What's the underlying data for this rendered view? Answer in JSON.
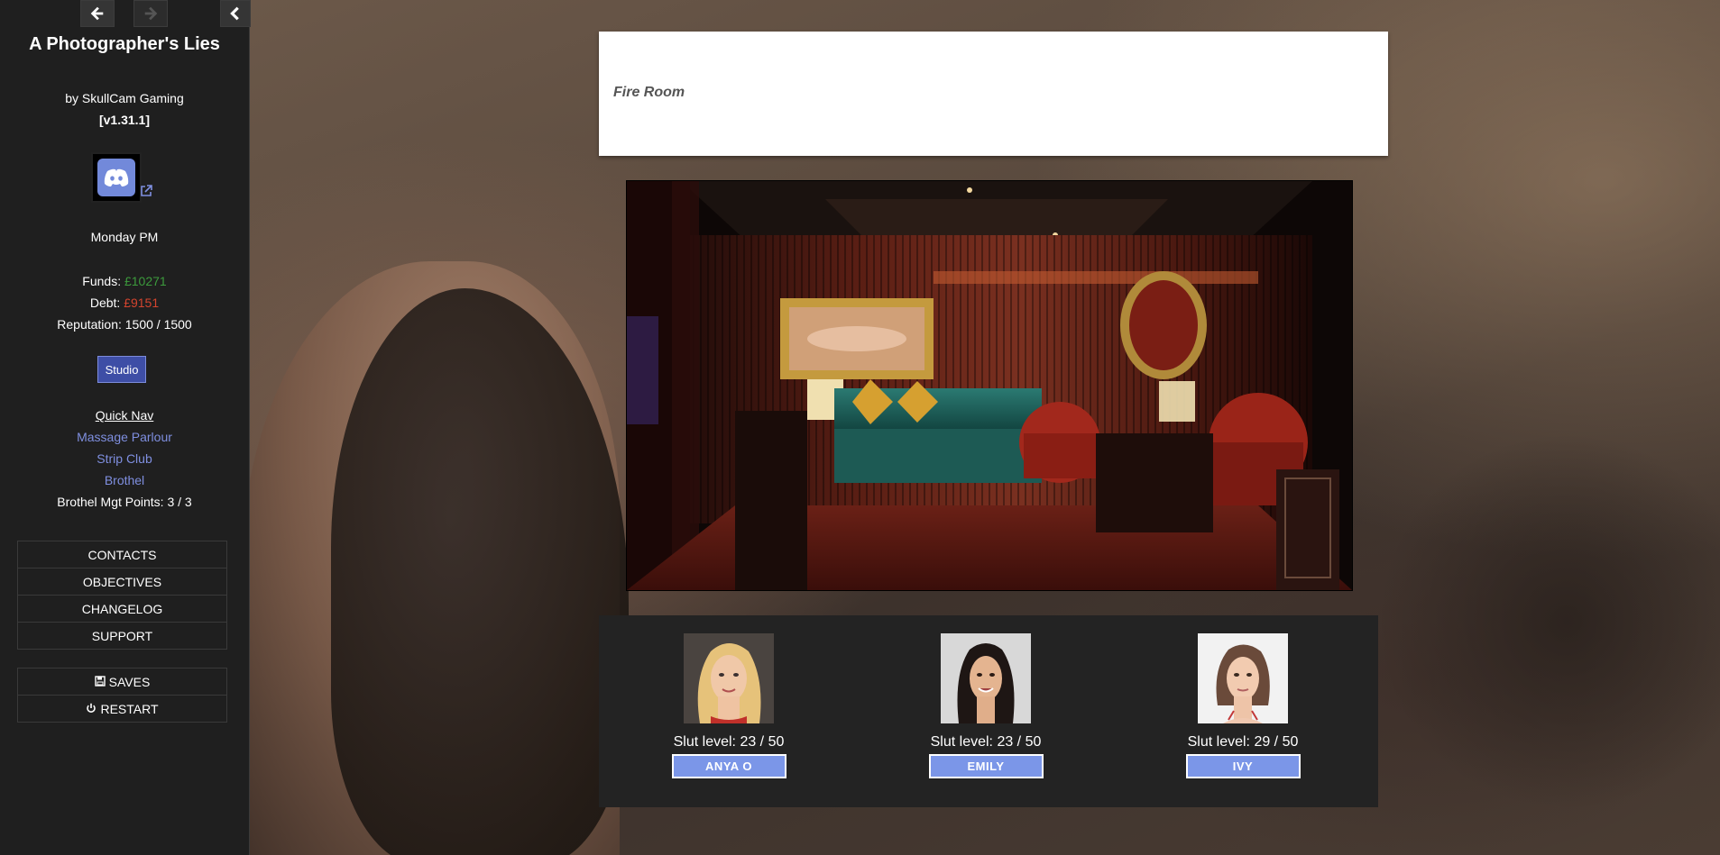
{
  "sidebar": {
    "back_icon": "arrow-left-icon",
    "forward_icon": "arrow-right-icon",
    "collapse_icon": "chevron-left-icon",
    "title": "A Photographer's Lies",
    "byline": "by SkullCam Gaming",
    "version": "[v1.31.1]",
    "discord_icon": "discord-icon",
    "external_link_icon": "external-link-icon",
    "time": "Monday PM",
    "funds_label": "Funds: ",
    "funds_value": "£10271",
    "debt_label": "Debt: ",
    "debt_value": "£9151",
    "reputation": "Reputation: 1500 / 1500",
    "studio_button": "Studio",
    "quick_nav_heading": "Quick Nav",
    "quick_nav": [
      "Massage Parlour",
      "Strip Club",
      "Brothel"
    ],
    "brothel_points": "Brothel Mgt Points: 3 / 3",
    "menu": [
      "CONTACTS",
      "OBJECTIVES",
      "CHANGELOG",
      "SUPPORT"
    ],
    "saves": "SAVES",
    "restart": "RESTART",
    "colors": {
      "background": "#1f1f1f",
      "link": "#7f8fe0",
      "funds": "#3c9a3c",
      "debt": "#d4442e",
      "studio_button": "#3e4ea6"
    }
  },
  "main": {
    "location": "Fire Room",
    "scene_image": "fire-room-lounge-image",
    "girls": [
      {
        "name": "ANYA O",
        "slut_level": "Slut level: 23 / 50",
        "level": 23,
        "max": 50
      },
      {
        "name": "EMILY",
        "slut_level": "Slut level: 23 / 50",
        "level": 23,
        "max": 50
      },
      {
        "name": "IVY",
        "slut_level": "Slut level: 29 / 50",
        "level": 29,
        "max": 50
      }
    ],
    "colors": {
      "name_button": "#7b96e8",
      "panel": "#232323"
    }
  }
}
